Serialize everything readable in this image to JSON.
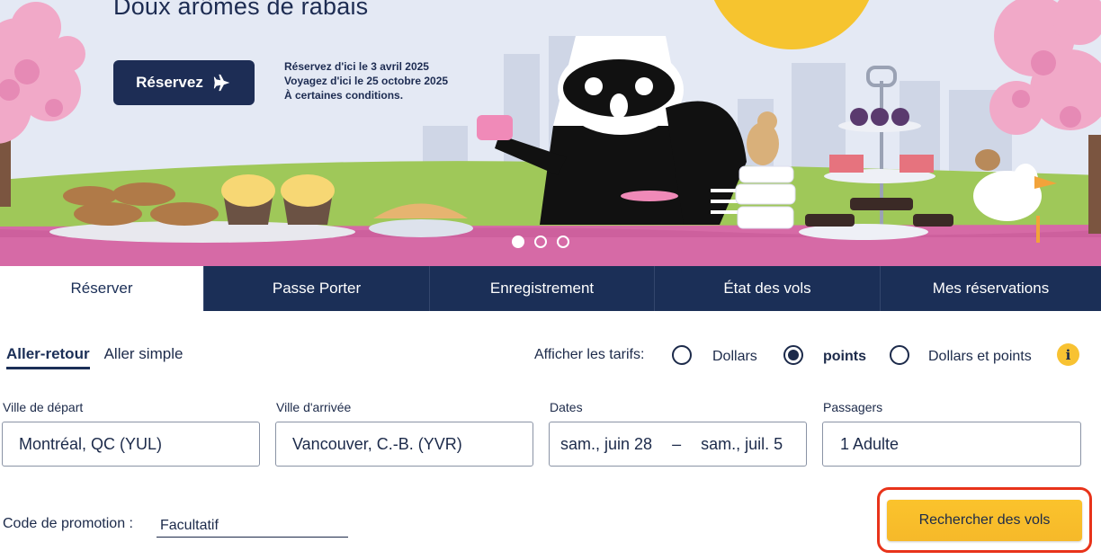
{
  "banner": {
    "title": "Doux arômes de rabais",
    "reserve_label": "Réservez",
    "promo_lines": [
      "Réservez d'ici le 3 avril 2025",
      "Voyagez d'ici le 25 octobre 2025",
      "À certaines conditions."
    ],
    "carousel_active_index": 0,
    "carousel_count": 3
  },
  "tabs": [
    {
      "label": "Réserver",
      "active": true
    },
    {
      "label": "Passe Porter",
      "active": false
    },
    {
      "label": "Enregistrement",
      "active": false
    },
    {
      "label": "État des vols",
      "active": false
    },
    {
      "label": "Mes réservations",
      "active": false
    }
  ],
  "trip_type": {
    "round_trip": "Aller-retour",
    "one_way": "Aller simple",
    "selected": "round_trip"
  },
  "fares": {
    "label": "Afficher les tarifs:",
    "options": [
      "Dollars",
      "points",
      "Dollars et points"
    ],
    "selected": "points",
    "info_glyph": "i"
  },
  "fields": {
    "departure": {
      "label": "Ville de départ",
      "value": "Montréal, QC (YUL)"
    },
    "arrival": {
      "label": "Ville d'arrivée",
      "value": "Vancouver, C.-B. (YVR)"
    },
    "dates": {
      "label": "Dates",
      "start": "sam., juin 28",
      "separator": "–",
      "end": "sam., juil. 5"
    },
    "passengers": {
      "label": "Passagers",
      "value": "1 Adulte"
    }
  },
  "promo": {
    "label": "Code de promotion :",
    "placeholder": "Facultatif"
  },
  "search": {
    "label": "Rechercher des vols"
  },
  "colors": {
    "navy": "#1b2f57",
    "accent_yellow": "#f8c232",
    "highlight_red": "#e8331a"
  }
}
